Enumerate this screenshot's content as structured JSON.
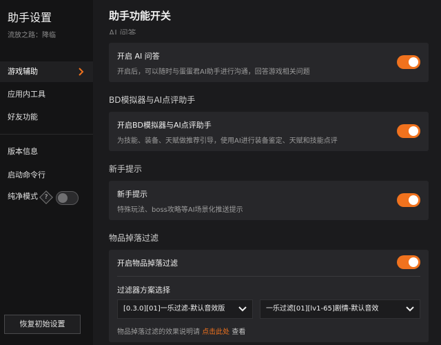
{
  "app": {
    "title": "助手设置",
    "subtitle": "流放之路：降临"
  },
  "sidebar": {
    "items": [
      {
        "label": "游戏辅助",
        "active": true
      },
      {
        "label": "应用内工具"
      },
      {
        "label": "好友功能"
      },
      {
        "label": "版本信息"
      },
      {
        "label": "启动命令行"
      }
    ],
    "pure_mode_label": "纯净模式",
    "help_glyph": "?",
    "pure_mode_on": false,
    "reset_label": "恢复初始设置"
  },
  "main": {
    "title": "助手功能开关",
    "cut_header": "AI 问答",
    "sections": [
      {
        "header": "",
        "card": {
          "title": "开启 AI 问答",
          "desc": "开启后，可以随时与蛋蛋君AI助手进行沟通，回答游戏相关问题",
          "enabled": true
        }
      },
      {
        "header": "BD模拟器与AI点评助手",
        "card": {
          "title": "开启BD模拟器与AI点评助手",
          "desc": "为技能、装备、天赋做推荐引导，使用AI进行装备鉴定、天赋和技能点评",
          "enabled": true
        }
      },
      {
        "header": "新手提示",
        "card": {
          "title": "新手提示",
          "desc": "特殊玩法、boss攻略等AI场景化推送提示",
          "enabled": true
        }
      },
      {
        "header": "物品掉落过滤",
        "card": {
          "title": "开启物品掉落过滤",
          "enabled": true
        }
      }
    ],
    "filter": {
      "label": "过滤器方案选择",
      "select1": "[0.3.0][01]一乐过滤-默认音效版",
      "select2": "一乐过滤[01][lv1-65]剧情-默认音效",
      "note_prefix": "物品掉落过滤的效果说明请",
      "note_link": "点击此处",
      "note_suffix": "查看"
    }
  },
  "colors": {
    "accent": "#f0721e",
    "sidebar_bg": "#141415",
    "main_bg": "#1b1b1d",
    "card_bg": "#27272a"
  },
  "icons": {
    "nav_active": "chevron-right-icon",
    "help": "help-icon",
    "select": "chevron-down-icon"
  }
}
